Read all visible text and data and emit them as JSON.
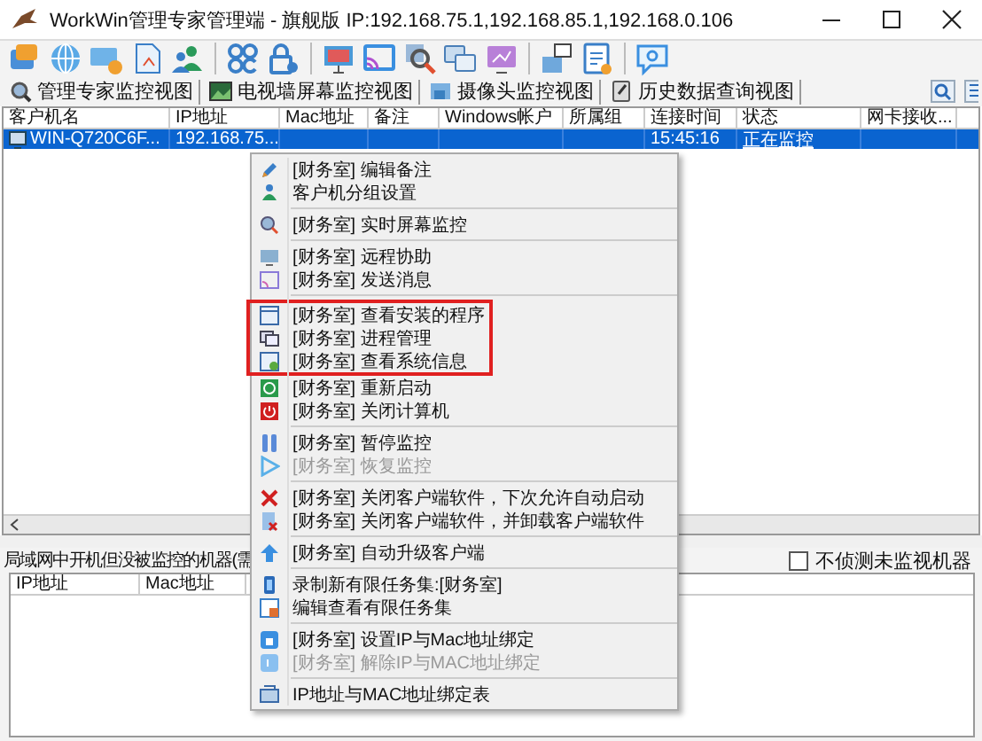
{
  "window": {
    "title": "WorkWin管理专家管理端 - 旗舰版 IP:192.168.75.1,192.168.85.1,192.168.0.106"
  },
  "tabs": [
    {
      "label": "管理专家监控视图"
    },
    {
      "label": "电视墙屏幕监控视图"
    },
    {
      "label": "摄像头监控视图"
    },
    {
      "label": "历史数据查询视图"
    }
  ],
  "table": {
    "columns": [
      "客户机名",
      "IP地址",
      "Mac地址",
      "备注",
      "Windows帐户",
      "所属组",
      "连接时间",
      "状态",
      "网卡接收..."
    ],
    "rows": [
      {
        "selected": true,
        "cells": [
          "WIN-Q720C6F...",
          "192.168.75...",
          "",
          "",
          "",
          "",
          "15:45:16",
          "正在监控",
          ""
        ]
      }
    ]
  },
  "context_menu": [
    {
      "label": "[财务室] 编辑备注",
      "disabled": false,
      "highlighted": false,
      "kind": "item"
    },
    {
      "label": "客户机分组设置",
      "disabled": false,
      "highlighted": false,
      "kind": "item"
    },
    {
      "kind": "separator"
    },
    {
      "label": "[财务室] 实时屏幕监控",
      "disabled": false,
      "highlighted": false,
      "kind": "item"
    },
    {
      "kind": "separator"
    },
    {
      "label": "[财务室] 远程协助",
      "disabled": false,
      "highlighted": false,
      "kind": "item"
    },
    {
      "label": "[财务室] 发送消息",
      "disabled": false,
      "highlighted": false,
      "kind": "item"
    },
    {
      "kind": "separator"
    },
    {
      "label": "[财务室] 查看安装的程序",
      "disabled": false,
      "highlighted": true,
      "kind": "item"
    },
    {
      "label": "[财务室] 进程管理",
      "disabled": false,
      "highlighted": true,
      "kind": "item"
    },
    {
      "label": "[财务室] 查看系统信息",
      "disabled": false,
      "highlighted": true,
      "kind": "item"
    },
    {
      "label": "[财务室] 重新启动",
      "disabled": false,
      "highlighted": false,
      "kind": "item"
    },
    {
      "label": "[财务室] 关闭计算机",
      "disabled": false,
      "highlighted": false,
      "kind": "item"
    },
    {
      "kind": "separator"
    },
    {
      "label": "[财务室] 暂停监控",
      "disabled": false,
      "highlighted": false,
      "kind": "item"
    },
    {
      "label": "[财务室] 恢复监控",
      "disabled": true,
      "highlighted": false,
      "kind": "item"
    },
    {
      "kind": "separator"
    },
    {
      "label": "[财务室] 关闭客户端软件，下次允许自动启动",
      "disabled": false,
      "highlighted": false,
      "kind": "item"
    },
    {
      "label": "[财务室] 关闭客户端软件，并卸载客户端软件",
      "disabled": false,
      "highlighted": false,
      "kind": "item"
    },
    {
      "kind": "separator"
    },
    {
      "label": "[财务室] 自动升级客户端",
      "disabled": false,
      "highlighted": false,
      "kind": "item"
    },
    {
      "kind": "separator"
    },
    {
      "label": "录制新有限任务集:[财务室]",
      "disabled": false,
      "highlighted": false,
      "kind": "item"
    },
    {
      "label": "编辑查看有限任务集",
      "disabled": false,
      "highlighted": false,
      "kind": "item"
    },
    {
      "kind": "separator"
    },
    {
      "label": "[财务室] 设置IP与Mac地址绑定",
      "disabled": false,
      "highlighted": false,
      "kind": "item"
    },
    {
      "label": "[财务室] 解除IP与MAC地址绑定",
      "disabled": true,
      "highlighted": false,
      "kind": "item"
    },
    {
      "kind": "separator"
    },
    {
      "label": "IP地址与MAC地址绑定表",
      "disabled": false,
      "highlighted": false,
      "kind": "item"
    }
  ],
  "unmonitored": {
    "label": "局域网中开机但没被监控的机器(需",
    "checkbox": {
      "label": "不侦测未监视机器",
      "checked": false
    },
    "columns": [
      "IP地址",
      "Mac地址"
    ]
  }
}
